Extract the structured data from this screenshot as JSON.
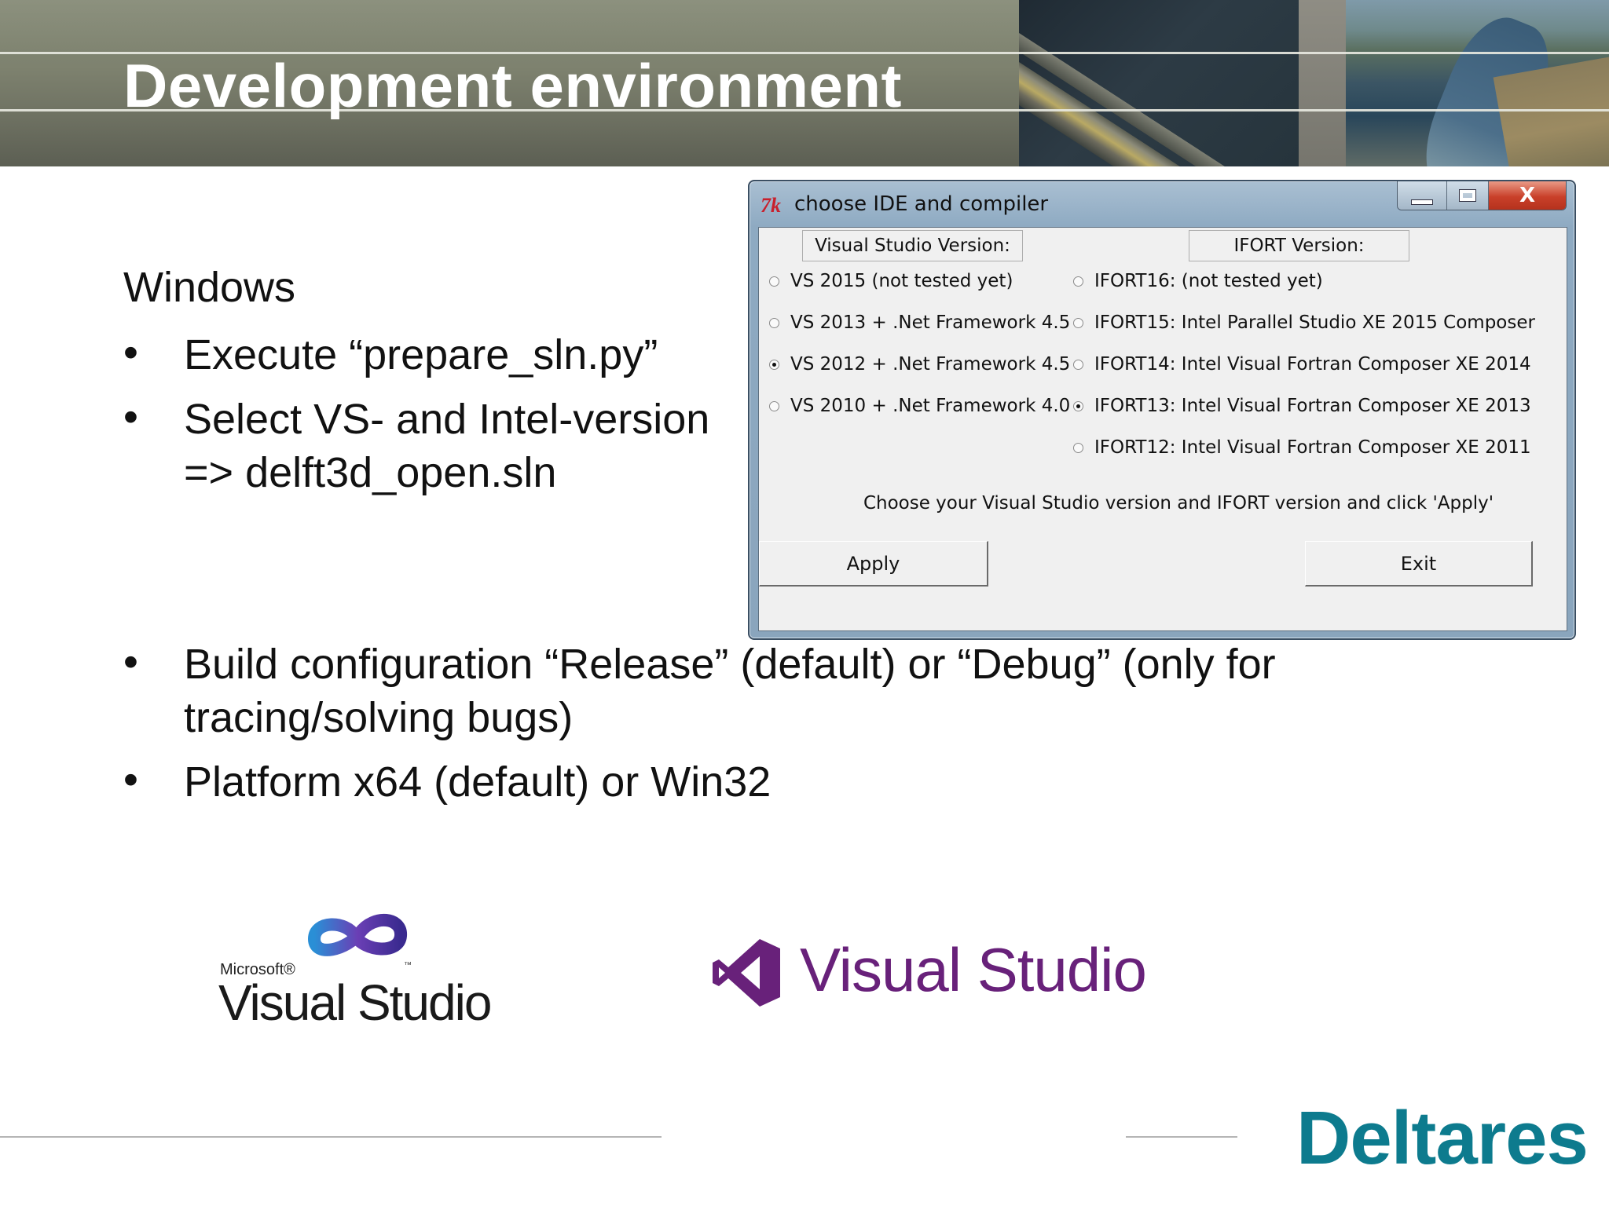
{
  "slide": {
    "title": "Development environment",
    "heading": "Windows",
    "bullets_top": [
      {
        "lines": [
          "Execute “prepare_sln.py”"
        ]
      },
      {
        "lines": [
          "Select VS- and Intel-version",
          "=> delft3d_open.sln"
        ]
      }
    ],
    "bullets_bottom": [
      {
        "lines": [
          "Build configuration “Release” (default) or “Debug” (only for",
          "tracing/solving bugs)"
        ]
      },
      {
        "lines": [
          "Platform x64 (default) or Win32"
        ]
      }
    ]
  },
  "dialog": {
    "title": "choose IDE and compiler",
    "icon": "tk-feather-icon",
    "vs_header": "Visual Studio Version:",
    "ifort_header": "IFORT Version:",
    "vs_options": [
      {
        "label": "VS 2015 (not tested yet)",
        "selected": false
      },
      {
        "label": "VS 2013 + .Net Framework 4.5",
        "selected": false
      },
      {
        "label": "VS 2012 + .Net Framework 4.5",
        "selected": true
      },
      {
        "label": "VS 2010 + .Net Framework 4.0",
        "selected": false
      }
    ],
    "ifort_options": [
      {
        "label": "IFORT16: (not tested yet)",
        "selected": false
      },
      {
        "label": "IFORT15: Intel Parallel Studio XE 2015 Composer",
        "selected": false
      },
      {
        "label": "IFORT14: Intel Visual Fortran Composer XE 2014",
        "selected": false
      },
      {
        "label": "IFORT13: Intel Visual Fortran Composer XE 2013",
        "selected": true
      },
      {
        "label": "IFORT12: Intel Visual Fortran Composer XE 2011",
        "selected": false
      }
    ],
    "instruction": "Choose your Visual Studio version and IFORT version and click 'Apply'",
    "apply_label": "Apply",
    "exit_label": "Exit",
    "window_buttons": {
      "minimize": "minimize-icon",
      "maximize": "maximize-icon",
      "close": "X"
    }
  },
  "logos": {
    "vs_old_vendor": "Microsoft®",
    "vs_old_name": "Visual Studio",
    "vs_old_tm": "™",
    "vs_new_name": "Visual Studio",
    "brand": "Deltares"
  },
  "colors": {
    "deltares_teal": "#0d7b8e",
    "vs_purple": "#68217a",
    "header_bg": "#7e826f"
  }
}
